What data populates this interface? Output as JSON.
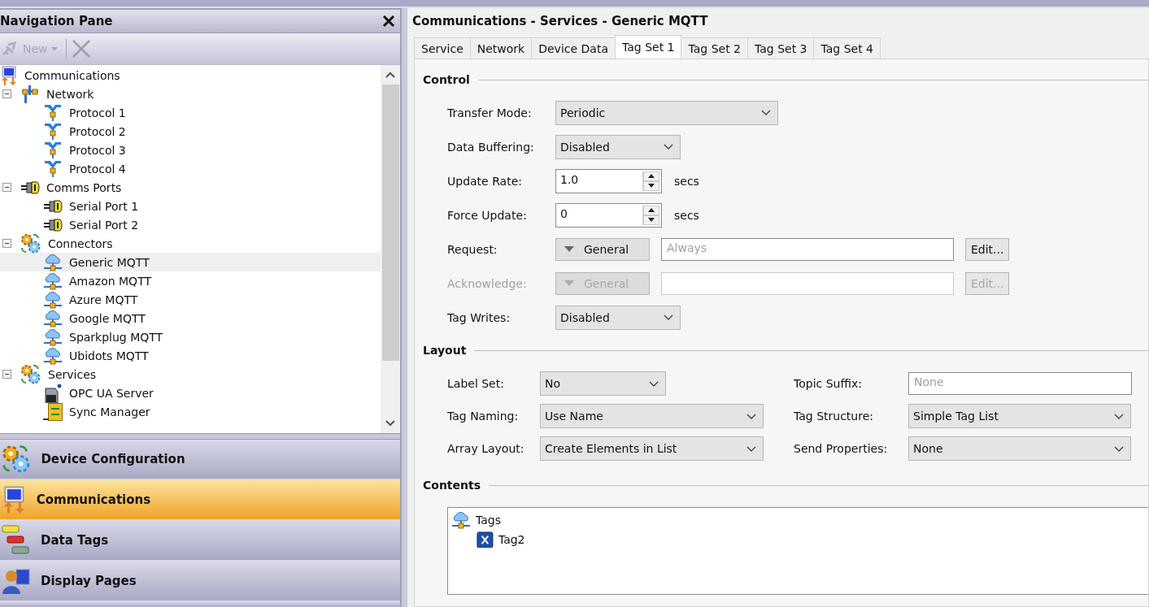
{
  "navigation_pane": {
    "title": "Navigation Pane",
    "toolbar": {
      "new_label": "New",
      "disabled": true
    },
    "tree": [
      {
        "label": "Communications",
        "kind": "comms",
        "selected": false,
        "children": [
          {
            "label": "Network",
            "kind": "network",
            "expanded": true,
            "selected": false,
            "children": [
              {
                "label": "Protocol 1",
                "kind": "protocol",
                "selected": false
              },
              {
                "label": "Protocol 2",
                "kind": "protocol",
                "selected": false
              },
              {
                "label": "Protocol 3",
                "kind": "protocol",
                "selected": false
              },
              {
                "label": "Protocol 4",
                "kind": "protocol",
                "selected": false
              }
            ]
          },
          {
            "label": "Comms Ports",
            "kind": "port",
            "expanded": true,
            "selected": false,
            "children": [
              {
                "label": "Serial Port 1",
                "kind": "port",
                "selected": false
              },
              {
                "label": "Serial Port 2",
                "kind": "port",
                "selected": false
              }
            ]
          },
          {
            "label": "Connectors",
            "kind": "gears",
            "expanded": true,
            "selected": false,
            "children": [
              {
                "label": "Generic MQTT",
                "kind": "cloud",
                "selected": true
              },
              {
                "label": "Amazon MQTT",
                "kind": "cloud",
                "selected": false
              },
              {
                "label": "Azure MQTT",
                "kind": "cloud",
                "selected": false
              },
              {
                "label": "Google MQTT",
                "kind": "cloud",
                "selected": false
              },
              {
                "label": "Sparkplug MQTT",
                "kind": "cloud",
                "selected": false
              },
              {
                "label": "Ubidots MQTT",
                "kind": "cloud",
                "selected": false
              }
            ]
          },
          {
            "label": "Services",
            "kind": "gears",
            "expanded": true,
            "selected": false,
            "children": [
              {
                "label": "OPC UA Server",
                "kind": "server",
                "selected": false
              },
              {
                "label": "Sync Manager",
                "kind": "sync",
                "selected": false
              }
            ]
          }
        ]
      }
    ],
    "sections": [
      {
        "label": "Device Configuration",
        "kind": "gears",
        "selected": false
      },
      {
        "label": "Communications",
        "kind": "comms",
        "selected": true
      },
      {
        "label": "Data Tags",
        "kind": "tags",
        "selected": false
      },
      {
        "label": "Display Pages",
        "kind": "display",
        "selected": false
      }
    ]
  },
  "editor": {
    "title": "Communications - Services - Generic MQTT",
    "tabs": [
      {
        "label": "Service",
        "selected": false
      },
      {
        "label": "Network",
        "selected": false
      },
      {
        "label": "Device Data",
        "selected": false
      },
      {
        "label": "Tag Set 1",
        "selected": true
      },
      {
        "label": "Tag Set 2",
        "selected": false
      },
      {
        "label": "Tag Set 3",
        "selected": false
      },
      {
        "label": "Tag Set 4",
        "selected": false
      }
    ],
    "control": {
      "heading": "Control",
      "rows": [
        {
          "kind": "select",
          "label": "Transfer Mode:",
          "value": "Periodic"
        },
        {
          "kind": "select",
          "label": "Data Buffering:",
          "value": "Disabled"
        },
        {
          "kind": "spin",
          "label": "Update Rate:",
          "value": "1.0",
          "unit": "secs"
        },
        {
          "kind": "spin",
          "label": "Force Update:",
          "value": "0",
          "unit": "secs"
        },
        {
          "kind": "condition",
          "label": "Request:",
          "button": "General",
          "placeholder": "Always",
          "edit": "Edit...",
          "disabled": false
        },
        {
          "kind": "condition",
          "label": "Acknowledge:",
          "button": "General",
          "edit": "Edit...",
          "disabled": true
        },
        {
          "kind": "select",
          "label": "Tag Writes:",
          "value": "Disabled"
        }
      ]
    },
    "layout": {
      "heading": "Layout",
      "fields": [
        {
          "kind": "select",
          "label": "Label Set:",
          "value": "No"
        },
        {
          "kind": "text",
          "label": "Topic Suffix:",
          "placeholder": "None"
        },
        {
          "kind": "select",
          "label": "Tag Naming:",
          "value": "Use Name"
        },
        {
          "kind": "select",
          "label": "Tag Structure:",
          "value": "Simple Tag List"
        },
        {
          "kind": "select",
          "label": "Array Layout:",
          "value": "Create Elements in List"
        },
        {
          "kind": "select",
          "label": "Send Properties:",
          "value": "None"
        }
      ]
    },
    "contents": {
      "heading": "Contents",
      "tree": [
        {
          "label": "Tags",
          "kind": "cloud",
          "children": [
            {
              "label": "Tag2",
              "kind": "tag"
            }
          ]
        }
      ]
    }
  }
}
